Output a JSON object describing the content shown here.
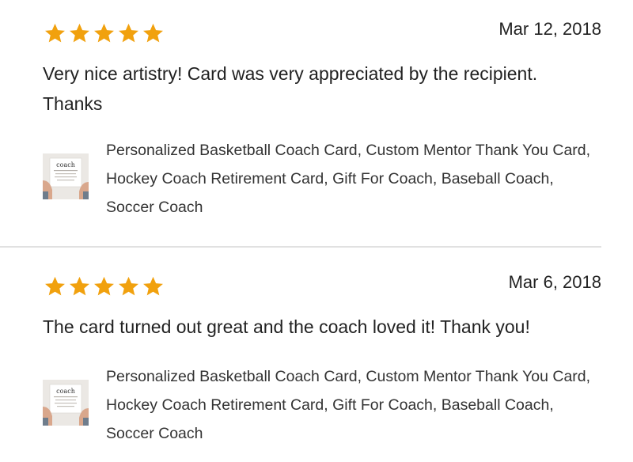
{
  "colors": {
    "star": "#f1a10e",
    "text": "#222222",
    "divider": "#e1e1e1"
  },
  "reviews": [
    {
      "rating": 5,
      "date": "Mar 12, 2018",
      "text": "Very nice artistry! Card was very appreciated by the recipient. Thanks",
      "listing": {
        "thumbnail_text": "coach",
        "title": "Personalized Basketball Coach Card, Custom Mentor Thank You Card, Hockey Coach Retirement Card, Gift For Coach, Baseball Coach, Soccer Coach"
      }
    },
    {
      "rating": 5,
      "date": "Mar 6, 2018",
      "text": "The card turned out great and the coach loved it! Thank you!",
      "listing": {
        "thumbnail_text": "coach",
        "title": "Personalized Basketball Coach Card, Custom Mentor Thank You Card, Hockey Coach Retirement Card, Gift For Coach, Baseball Coach, Soccer Coach"
      }
    }
  ]
}
